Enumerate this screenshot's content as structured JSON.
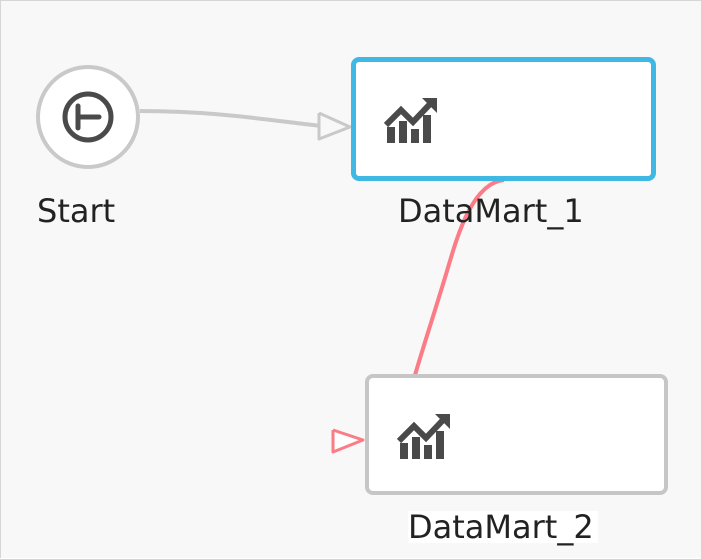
{
  "workflow": {
    "nodes": [
      {
        "label": "Start",
        "icon": "start-icon",
        "selected": false
      },
      {
        "label": "DataMart_1",
        "icon": "data-mart-chart-icon",
        "selected": true
      },
      {
        "label": "DataMart_2",
        "icon": "data-mart-chart-icon",
        "selected": false
      }
    ],
    "links": [
      {
        "from": "Start",
        "to": "DataMart_1",
        "color": "#c9c9c9"
      },
      {
        "from": "DataMart_1",
        "to": "DataMart_2",
        "color": "#fb7c86"
      }
    ]
  },
  "colors": {
    "selected_border": "#3fb8e3",
    "node_border": "#c6c6c6",
    "error_link": "#fb7c86",
    "default_link": "#c9c9c9",
    "icon": "#4a4a4a"
  }
}
